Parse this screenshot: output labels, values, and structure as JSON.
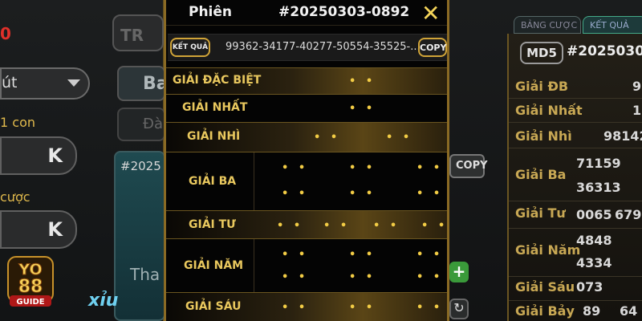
{
  "left": {
    "red_value": "0",
    "dropdown_value": "út",
    "label_one": "1 con",
    "amount_one": "K",
    "label_two": "cược",
    "amount_two": "K",
    "top_button": "TR",
    "button_b": "Ba",
    "button_d": "Đà",
    "card_session": "#2025",
    "card_text": "Tha",
    "xiu_label": "xỉu"
  },
  "logo": {
    "line1": "YO",
    "line2": "88",
    "line3": "GUIDE"
  },
  "modal": {
    "phien_label": "Phiên",
    "session_id": "#20250303-0892",
    "close_icon": "close-x",
    "result_label": "KẾT QUẢ",
    "result_value": "99362-34177-40277-50554-35525-...",
    "copy_label": "COPY",
    "prizes": [
      {
        "name": "GIẢI ĐẶC BIỆT"
      },
      {
        "name": "GIẢI NHẤT"
      },
      {
        "name": "GIẢI NHÌ"
      },
      {
        "name": "GIẢI BA"
      },
      {
        "name": "GIẢI TƯ"
      },
      {
        "name": "GIẢI NĂM"
      },
      {
        "name": "GIẢI SÁU"
      }
    ],
    "dots": "• •"
  },
  "right": {
    "tab_bang_cuoc": "BẢNG CƯỢC",
    "tab_ket_qua": "KẾT QUẢ",
    "md5_label": "MD5",
    "md5_value": "#2025030",
    "copy_label": "COPY",
    "rows": [
      {
        "label": "Giải ĐB",
        "values": [
          "9"
        ]
      },
      {
        "label": "Giải Nhất",
        "values": [
          "1"
        ]
      },
      {
        "label": "Giải Nhì",
        "values": [
          "98142"
        ]
      },
      {
        "label": "Giải Ba",
        "values": [
          "71159",
          "36313"
        ]
      },
      {
        "label": "Giải Tư",
        "values": [
          "0065",
          "679"
        ]
      },
      {
        "label": "Giải Năm",
        "values": [
          "4848",
          "4334"
        ]
      },
      {
        "label": "Giải Sáu",
        "values": [
          "073"
        ]
      },
      {
        "label": "Giải Bảy",
        "values": [
          "89",
          "64"
        ]
      }
    ],
    "plus_label": "+",
    "return_icon": "refresh"
  },
  "colors": {
    "gold": "#e9c85e",
    "dot_gold": "#f2cc45",
    "modal_bg": "#040404",
    "accent_red": "#e0302a"
  }
}
